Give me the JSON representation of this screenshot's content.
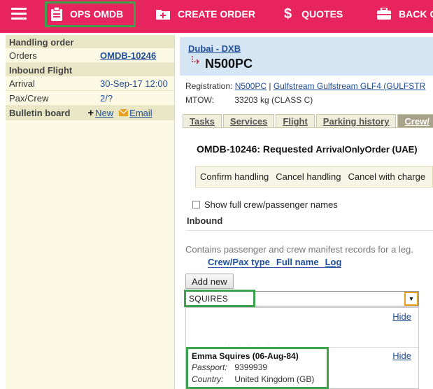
{
  "nav": {
    "ops_label": "OPS OMDB",
    "create_label": "CREATE ORDER",
    "quotes_label": "QUOTES",
    "back_label": "BACK O"
  },
  "left": {
    "handling_header": "Handling order",
    "orders_label": "Orders",
    "orders_value": "OMDB-10246",
    "inbound_header": "Inbound Flight",
    "arrival_label": "Arrival",
    "arrival_value": "30-Sep-17 12:00",
    "paxcrew_label": "Pax/Crew",
    "paxcrew_value": "2/?",
    "bulletin_label": "Bulletin board",
    "new_label": "New",
    "email_label": "Email"
  },
  "flight": {
    "destination": "Dubai - DXB",
    "tail": "N500PC",
    "registration_label": "Registration:",
    "registration_value": "N500PC",
    "aircraft": "Gulfstream Gulfstream GLF4 (GULFSTR",
    "mtow_label": "MTOW:",
    "mtow_value": "33203 kg (CLASS C)"
  },
  "tabs": [
    "Tasks",
    "Services",
    "Flight",
    "Parking history",
    "Crew/"
  ],
  "order": {
    "title": "OMDB-10246: Requested",
    "subtitle": "ArrivalOnlyOrder (UAE)"
  },
  "actions": [
    "Confirm handling",
    "Cancel handling",
    "Cancel with charge"
  ],
  "crew": {
    "show_full_label": "Show full crew/passenger names",
    "inbound_header": "Inbound",
    "contains_text": "Contains passenger and crew manifest records for a leg.",
    "col_type": "Crew/Pax type",
    "col_name": "Full name",
    "col_log": "Log",
    "add_new_label": "Add new",
    "search_value": "SQUIRES",
    "hide_label": "Hide",
    "result_name": "Emma Squires (06-Aug-84)",
    "passport_label": "Passport:",
    "passport_value": "9399939",
    "country_label": "Country:",
    "country_value": "United Kingdom (GB)"
  },
  "colors": {
    "nav_bg": "#e8245e",
    "highlight": "#3aa34b",
    "link": "#1f4e9a",
    "panel_bg": "#fbf9e3"
  }
}
